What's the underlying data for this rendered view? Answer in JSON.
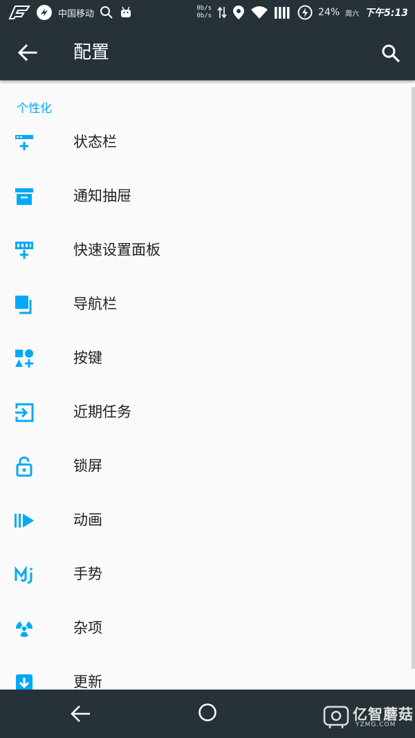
{
  "status_bar": {
    "carrier": "中国移动",
    "net_up": "0b/s",
    "net_down": "0b/s",
    "battery": "24%",
    "day": "周六",
    "time": "下午5:13",
    "icons": [
      "app-logo-icon",
      "carrier-logo-icon",
      "search-icon",
      "android-icon",
      "data-transfer-icon",
      "location-icon",
      "wifi-icon",
      "signal-icon",
      "battery-charging-icon"
    ]
  },
  "app_bar": {
    "title": "配置",
    "back_icon": "arrow-back-icon",
    "search_icon": "search-icon"
  },
  "section": {
    "title": "个性化"
  },
  "items": [
    {
      "label": "状态栏",
      "icon": "status-bar-icon"
    },
    {
      "label": "通知抽屉",
      "icon": "archive-drawer-icon"
    },
    {
      "label": "快速设置面板",
      "icon": "quick-settings-icon"
    },
    {
      "label": "导航栏",
      "icon": "navigation-bar-icon"
    },
    {
      "label": "按键",
      "icon": "shapes-icon"
    },
    {
      "label": "近期任务",
      "icon": "recent-tasks-icon"
    },
    {
      "label": "锁屏",
      "icon": "lock-open-icon"
    },
    {
      "label": "动画",
      "icon": "animation-icon"
    },
    {
      "label": "手势",
      "icon": "gesture-icon"
    },
    {
      "label": "杂项",
      "icon": "radiation-icon"
    },
    {
      "label": "更新",
      "icon": "update-download-icon"
    }
  ],
  "nav_bar": {
    "back_icon": "nav-back-icon",
    "home_icon": "nav-home-icon"
  },
  "watermark": {
    "text": "亿智蘑菇",
    "sub": "YZMG.COM"
  },
  "colors": {
    "accent": "#03a9f4",
    "toolbar": "#263238",
    "background": "#fafafa",
    "text": "#212121"
  }
}
